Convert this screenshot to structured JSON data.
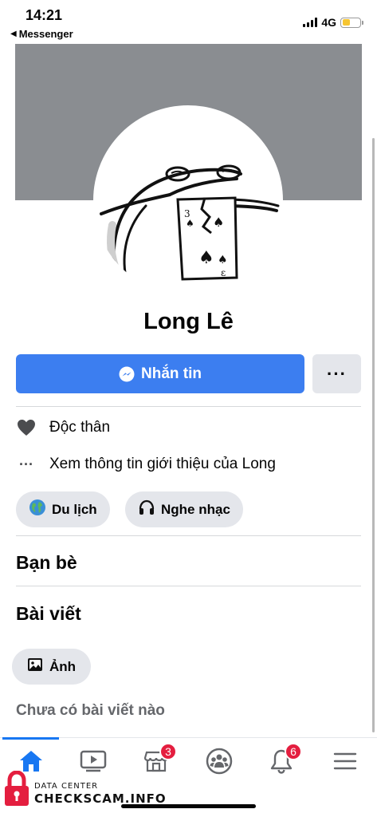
{
  "status_bar": {
    "time": "14:21",
    "back_app": "Messenger",
    "network": "4G",
    "battery_level": 0.45,
    "battery_color": "#f6c531"
  },
  "profile": {
    "name": "Long Lê",
    "cover_color": "#8a8d91"
  },
  "actions": {
    "message_label": "Nhắn tin",
    "message_color": "#3c7ef0",
    "more_label": "···"
  },
  "intro": {
    "relationship": "Độc thân",
    "about_link": "Xem thông tin giới thiệu của Long"
  },
  "hobbies": [
    {
      "label": "Du lịch",
      "icon": "globe-icon"
    },
    {
      "label": "Nghe nhạc",
      "icon": "headphones-icon"
    }
  ],
  "sections": {
    "friends_title": "Bạn bè",
    "posts_title": "Bài viết",
    "photos_label": "Ảnh",
    "no_posts": "Chưa có bài viết nào"
  },
  "tabbar": {
    "tabs": [
      {
        "name": "home",
        "icon": "home-icon",
        "active": true
      },
      {
        "name": "watch",
        "icon": "video-icon"
      },
      {
        "name": "marketplace",
        "icon": "marketplace-icon",
        "badge": "3"
      },
      {
        "name": "groups",
        "icon": "groups-icon"
      },
      {
        "name": "notifications",
        "icon": "bell-icon",
        "badge": "6"
      },
      {
        "name": "menu",
        "icon": "menu-icon"
      }
    ],
    "accent_color": "#1877f2",
    "badge_color": "#e41e3f"
  },
  "watermark": {
    "line1": "DATA CENTER",
    "line2": "CHECKSCAM.INFO"
  }
}
